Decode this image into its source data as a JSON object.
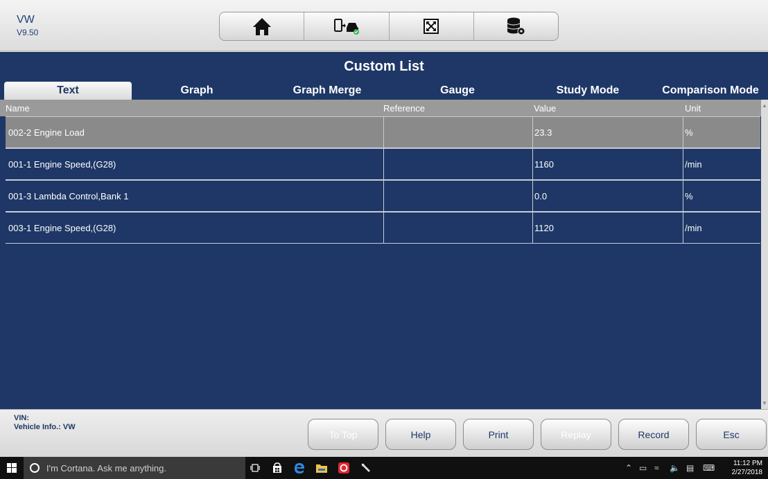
{
  "app": {
    "name": "VW",
    "version": "V9.50"
  },
  "toolbar": {
    "icons": [
      "home-icon",
      "vehicle-connect-icon",
      "fullscreen-icon",
      "database-settings-icon"
    ]
  },
  "title": "Custom List",
  "tabs": [
    {
      "label": "Text",
      "active": true
    },
    {
      "label": "Graph",
      "active": false
    },
    {
      "label": "Graph Merge",
      "active": false
    },
    {
      "label": "Gauge",
      "active": false
    },
    {
      "label": "Study Mode",
      "active": false
    },
    {
      "label": "Comparison Mode",
      "active": false
    }
  ],
  "table": {
    "columns": [
      "Name",
      "Reference",
      "Value",
      "Unit"
    ],
    "rows": [
      {
        "name": "002-2 Engine Load",
        "reference": "",
        "value": "23.3",
        "unit": "%",
        "selected": true
      },
      {
        "name": "001-1 Engine Speed,(G28)",
        "reference": "",
        "value": "1160",
        "unit": "/min",
        "selected": false
      },
      {
        "name": "001-3 Lambda Control,Bank 1",
        "reference": "",
        "value": "0.0",
        "unit": "%",
        "selected": false
      },
      {
        "name": "003-1 Engine Speed,(G28)",
        "reference": "",
        "value": "1120",
        "unit": "/min",
        "selected": false
      }
    ]
  },
  "footer": {
    "vin_label": "VIN:",
    "vehicle_info": "Vehicle Info.: VW",
    "buttons": [
      {
        "label": "To Top",
        "enabled": false
      },
      {
        "label": "Help",
        "enabled": true
      },
      {
        "label": "Print",
        "enabled": true
      },
      {
        "label": "Replay",
        "enabled": false
      },
      {
        "label": "Record",
        "enabled": true
      },
      {
        "label": "Esc",
        "enabled": true
      }
    ]
  },
  "taskbar": {
    "search_placeholder": "I'm Cortana. Ask me anything.",
    "time": "11:12 PM",
    "date": "2/27/2018"
  },
  "colors": {
    "primary": "#1e3766",
    "selected_row": "#8a8a8a",
    "header_row": "#9a9a9a"
  }
}
